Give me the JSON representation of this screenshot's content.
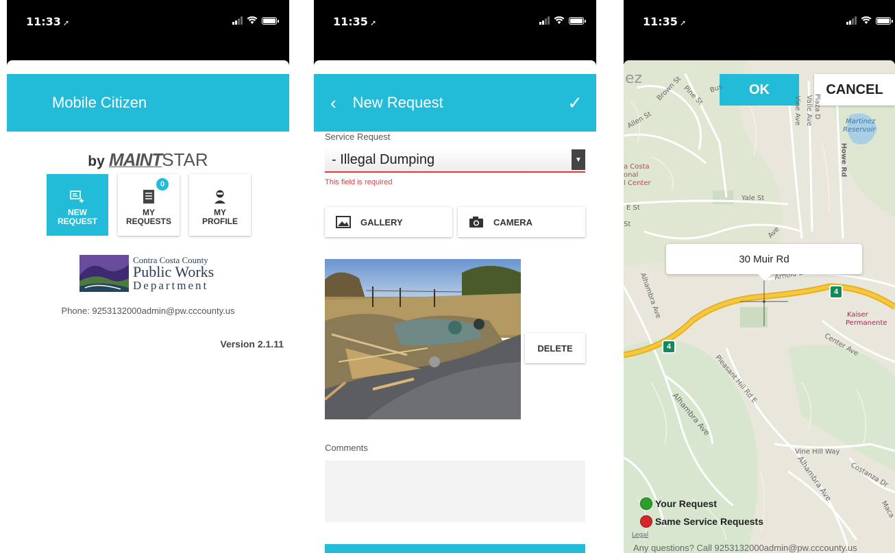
{
  "screen1": {
    "status": {
      "time": "11:33"
    },
    "app_title": "Mobile Citizen",
    "brand": {
      "by": "by",
      "maint": "MAINT",
      "star": "STAR"
    },
    "tiles": [
      {
        "label1": "NEW",
        "label2": "REQUEST",
        "icon": "new-request-icon",
        "active": true
      },
      {
        "label1": "MY",
        "label2": "REQUESTS",
        "icon": "list-icon",
        "badge": "0"
      },
      {
        "label1": "MY",
        "label2": "PROFILE",
        "icon": "user-icon"
      }
    ],
    "org": {
      "line1": "Contra Costa County",
      "line2": "Public Works",
      "line3": "Department"
    },
    "phone": "Phone: 9253132000admin@pw.cccounty.us",
    "version": "Version 2.1.11"
  },
  "screen2": {
    "status": {
      "time": "11:35"
    },
    "app_title": "New Request",
    "service_request_label": "Service Request",
    "service_request_value": "- Illegal Dumping",
    "error_text": "This field is required",
    "gallery_label": "GALLERY",
    "camera_label": "CAMERA",
    "delete_label": "DELETE",
    "comments_label": "Comments"
  },
  "screen3": {
    "status": {
      "time": "11:35"
    },
    "ok_label": "OK",
    "cancel_label": "CANCEL",
    "callout_address": "30 Muir Rd",
    "legend": [
      {
        "label": "Your Request",
        "color": "#2e9e2e"
      },
      {
        "label": "Same Service Requests",
        "color": "#d62828"
      }
    ],
    "legal": "Legal",
    "footer": "Any questions? Call 9253132000admin@pw.cccounty.us",
    "map_labels": {
      "ez": "ez",
      "brown": "Brown St",
      "pine": "Pine St",
      "bush": "Bus",
      "allen": "Allen St",
      "vine": "Vine Ave",
      "vaile": "Vaile Ave",
      "plaza": "Plaza D",
      "howe": "Howe Rd",
      "martinez1": "Martinez",
      "martinez2": "Reservoir",
      "costa1": "a Costa",
      "costa2": "onal",
      "costa3": "l Center",
      "yale": "Yale St",
      "est": "E St",
      "st": "St",
      "ave": "Ave",
      "arnold": "Arnold Dr",
      "alhambra1": "Alhambra Ave",
      "kaiser1": "Kaiser",
      "kaiser2": "Permanente",
      "center": "Center Ave",
      "pleasant": "Pleasant Hill Rd E",
      "alhambra2": "Alhambra Ave",
      "vinehill": "Vine Hill Way",
      "alhambra3": "Alhambra Ave",
      "costanza": "Costanza Dr",
      "maca": "Maca"
    },
    "hwy": "4"
  },
  "colors": {
    "accent": "#22bcd9",
    "error": "#e53935"
  }
}
